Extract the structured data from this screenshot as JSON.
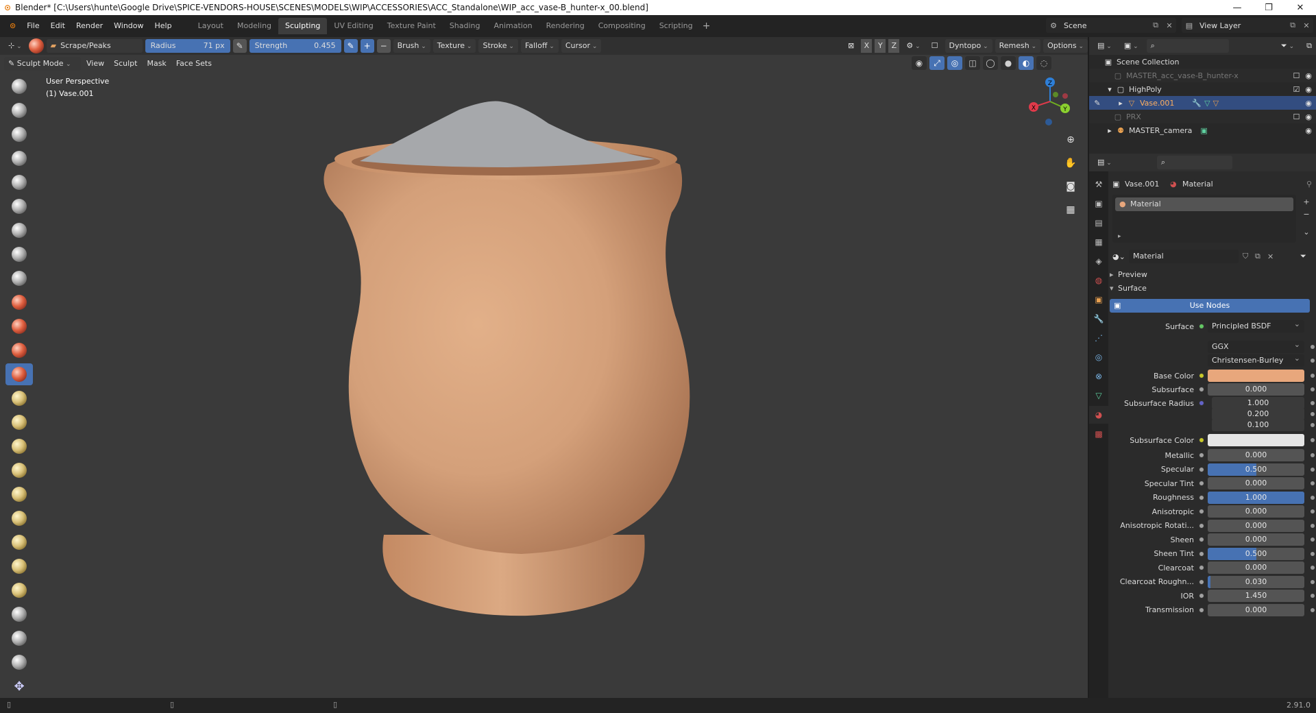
{
  "window": {
    "title": "Blender* [C:\\Users\\hunte\\Google Drive\\SPICE-VENDORS-HOUSE\\SCENES\\MODELS\\WIP\\ACCESSORIES\\ACC_Standalone\\WIP_acc_vase-B_hunter-x_00.blend]",
    "minimize": "—",
    "maximize": "❐",
    "close": "✕"
  },
  "menu": [
    "File",
    "Edit",
    "Render",
    "Window",
    "Help"
  ],
  "workspaces": [
    "Layout",
    "Modeling",
    "Sculpting",
    "UV Editing",
    "Texture Paint",
    "Shading",
    "Animation",
    "Rendering",
    "Compositing",
    "Scripting"
  ],
  "active_workspace": "Sculpting",
  "scene": "Scene",
  "view_layer": "View Layer",
  "tool_header": {
    "brush_name": "Scrape/Peaks",
    "radius_label": "Radius",
    "radius_value": "71 px",
    "strength_label": "Strength",
    "strength_value": "0.455",
    "brush": "Brush",
    "texture": "Texture",
    "stroke": "Stroke",
    "falloff": "Falloff",
    "cursor": "Cursor",
    "axes": [
      "X",
      "Y",
      "Z"
    ],
    "dyntopo": "Dyntopo",
    "remesh": "Remesh",
    "options": "Options"
  },
  "viewport_header": {
    "mode": "Sculpt Mode",
    "menus": [
      "View",
      "Sculpt",
      "Mask",
      "Face Sets"
    ]
  },
  "viewport": {
    "perspective": "User Perspective",
    "object": "(1) Vase.001",
    "vase_color": "#d4a07a",
    "sand_color": "#a6a8ab"
  },
  "gizmo": {
    "x": "X",
    "y": "Y",
    "z": "Z"
  },
  "outliner": {
    "root": "Scene Collection",
    "rows": [
      {
        "name": "MASTER_acc_vase-B_hunter-x"
      },
      {
        "name": "HighPoly"
      },
      {
        "name": "Vase.001"
      },
      {
        "name": "PRX"
      },
      {
        "name": "MASTER_camera"
      }
    ]
  },
  "properties": {
    "breadcrumb_object": "Vase.001",
    "breadcrumb_material": "Material",
    "slot_name": "Material",
    "material_name": "Material",
    "panel_preview": "Preview",
    "panel_surface": "Surface",
    "use_nodes": "Use Nodes",
    "surface_label": "Surface",
    "surface_value": "Principled BSDF",
    "distribution": "GGX",
    "subsurface_method": "Christensen-Burley",
    "base_color_label": "Base Color",
    "base_color": "#e8a77c",
    "subsurface_label": "Subsurface",
    "subsurface_value": "0.000",
    "subsurface_radius_label": "Subsurface Radius",
    "subsurface_radius": [
      "1.000",
      "0.200",
      "0.100"
    ],
    "subsurface_color_label": "Subsurface Color",
    "subsurface_color": "#e6e6e6",
    "params": [
      {
        "label": "Metallic",
        "value": "0.000",
        "fill": 0
      },
      {
        "label": "Specular",
        "value": "0.500",
        "fill": 0.5
      },
      {
        "label": "Specular Tint",
        "value": "0.000",
        "fill": 0
      },
      {
        "label": "Roughness",
        "value": "1.000",
        "fill": 1
      },
      {
        "label": "Anisotropic",
        "value": "0.000",
        "fill": 0
      },
      {
        "label": "Anisotropic Rotati...",
        "value": "0.000",
        "fill": 0
      },
      {
        "label": "Sheen",
        "value": "0.000",
        "fill": 0
      },
      {
        "label": "Sheen Tint",
        "value": "0.500",
        "fill": 0.5
      },
      {
        "label": "Clearcoat",
        "value": "0.000",
        "fill": 0
      },
      {
        "label": "Clearcoat Roughn...",
        "value": "0.030",
        "fill": 0.03
      },
      {
        "label": "IOR",
        "value": "1.450",
        "fill": 0
      },
      {
        "label": "Transmission",
        "value": "0.000",
        "fill": 0
      }
    ]
  },
  "status": {
    "version": "2.91.0"
  }
}
